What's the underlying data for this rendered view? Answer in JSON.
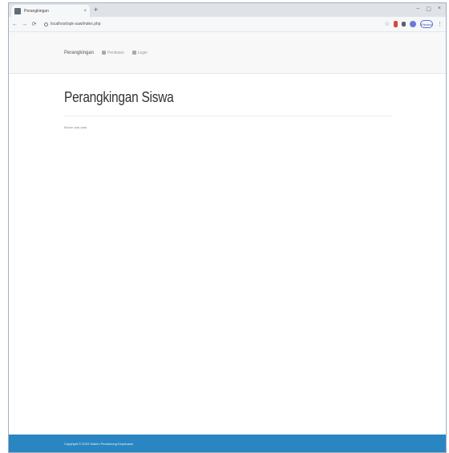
{
  "browser": {
    "tab_title": "Perangkingan",
    "tab_close": "×",
    "new_tab": "+",
    "window_controls": [
      "–",
      "▢",
      "×"
    ],
    "nav": [
      "←",
      "→",
      "⟳"
    ],
    "url": "localhost/spk-saw/index.php",
    "profile_label": "Paused"
  },
  "site": {
    "brand": "Perangkingan",
    "nav_links": [
      "Penilaian",
      "Login"
    ]
  },
  "page": {
    "title": "Perangkingan Siswa",
    "small_text": "Belum ada data"
  },
  "footer": {
    "text": "Copyright © 2023 Sistem Pendukung Keputusan"
  },
  "colors": {
    "footer_bg": "#2a86c3",
    "navbar_bg": "#f8f8f8"
  }
}
